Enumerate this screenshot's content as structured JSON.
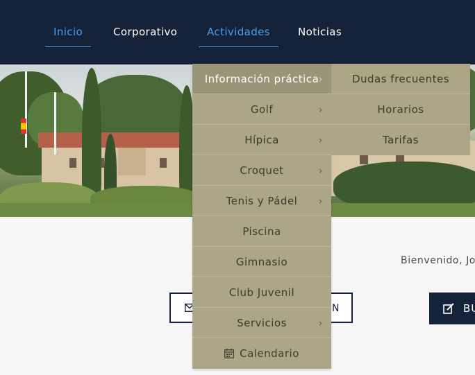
{
  "nav": {
    "items": [
      {
        "label": "Inicio",
        "active": true
      },
      {
        "label": "Corporativo",
        "active": false
      },
      {
        "label": "Actividades",
        "active": true
      },
      {
        "label": "Noticias",
        "active": false
      }
    ]
  },
  "dropdown": {
    "items": [
      {
        "label": "Información práctica",
        "has_submenu": true
      },
      {
        "label": "Golf",
        "has_submenu": true
      },
      {
        "label": "Hípica",
        "has_submenu": true
      },
      {
        "label": "Croquet",
        "has_submenu": true
      },
      {
        "label": "Tenis y Pádel",
        "has_submenu": true
      },
      {
        "label": "Piscina",
        "has_submenu": false
      },
      {
        "label": "Gimnasio",
        "has_submenu": false
      },
      {
        "label": "Club Juvenil",
        "has_submenu": false
      },
      {
        "label": "Servicios",
        "has_submenu": true
      },
      {
        "label": "Calendario",
        "has_submenu": false,
        "icon": "calendar-icon"
      }
    ],
    "chevron": "›"
  },
  "submenu": {
    "items": [
      {
        "label": "Dudas frecuentes"
      },
      {
        "label": "Horarios"
      },
      {
        "label": "Tarifas"
      }
    ]
  },
  "main": {
    "welcome": "Bienvenido, Jo",
    "contact_button": {
      "label": "N",
      "icon": "envelope-icon"
    },
    "book_button": {
      "label": "BU",
      "icon": "edit-icon"
    }
  },
  "colors": {
    "topbar": "#15233a",
    "accent": "#4a9ee8",
    "menu_bg": "#aca587",
    "menu_active": "#9a9479"
  }
}
